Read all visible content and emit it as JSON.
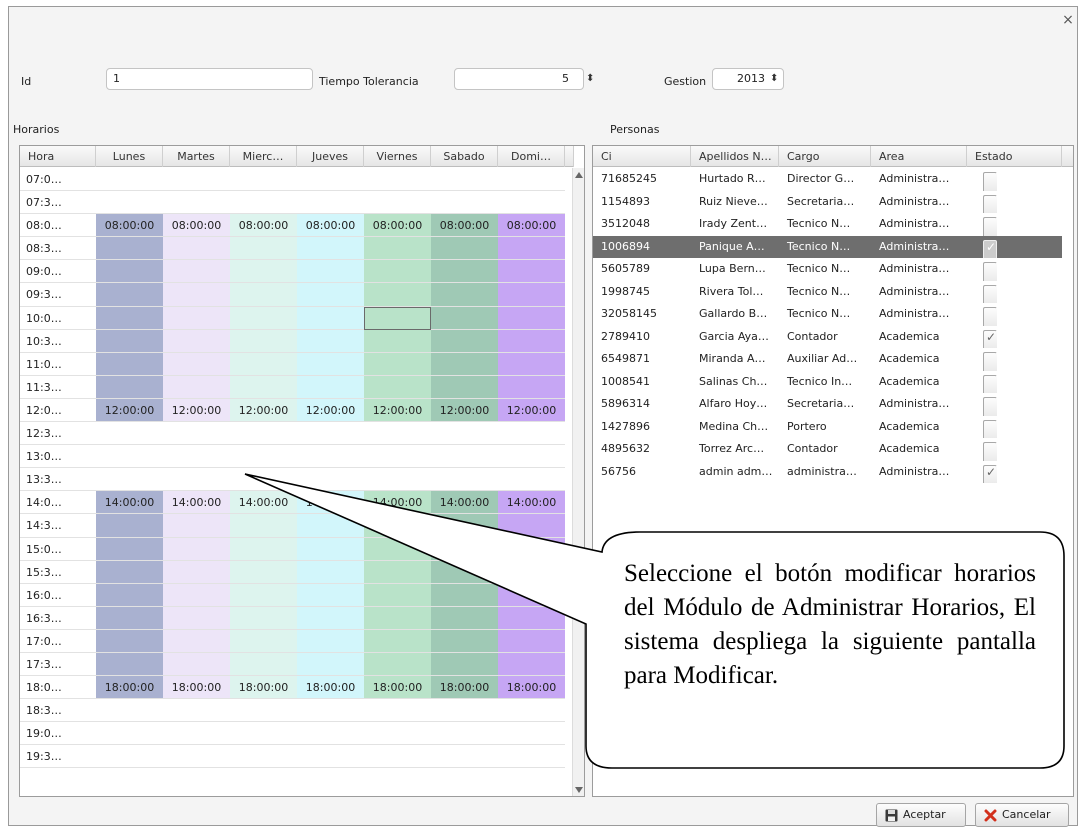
{
  "form": {
    "id_label": "Id",
    "id_value": "1",
    "tolerancia_label": "Tiempo Tolerancia",
    "tolerancia_value": "5",
    "gestion_label": "Gestion",
    "gestion_value": "2013"
  },
  "horarios": {
    "section_label": "Horarios",
    "columns": [
      "Hora",
      "Lunes",
      "Martes",
      "Mierc…",
      "Jueves",
      "Viernes",
      "Sabado",
      "Domi…"
    ],
    "day_colors": [
      "#a9b1d0",
      "#ede5f8",
      "#ddf4ee",
      "#d2f6fb",
      "#b9e3c9",
      "#9fc9b5",
      "#c6a6f4"
    ],
    "rows": [
      {
        "hora": "07:0…",
        "filled": false,
        "label": ""
      },
      {
        "hora": "07:3…",
        "filled": false,
        "label": ""
      },
      {
        "hora": "08:0…",
        "filled": true,
        "label": "08:00:00"
      },
      {
        "hora": "08:3…",
        "filled": true,
        "label": ""
      },
      {
        "hora": "09:0…",
        "filled": true,
        "label": ""
      },
      {
        "hora": "09:3…",
        "filled": true,
        "label": ""
      },
      {
        "hora": "10:0…",
        "filled": true,
        "label": ""
      },
      {
        "hora": "10:3…",
        "filled": true,
        "label": ""
      },
      {
        "hora": "11:0…",
        "filled": true,
        "label": ""
      },
      {
        "hora": "11:3…",
        "filled": true,
        "label": ""
      },
      {
        "hora": "12:0…",
        "filled": true,
        "label": "12:00:00"
      },
      {
        "hora": "12:3…",
        "filled": false,
        "label": ""
      },
      {
        "hora": "13:0…",
        "filled": false,
        "label": ""
      },
      {
        "hora": "13:3…",
        "filled": false,
        "label": ""
      },
      {
        "hora": "14:0…",
        "filled": true,
        "label": "14:00:00"
      },
      {
        "hora": "14:3…",
        "filled": true,
        "label": ""
      },
      {
        "hora": "15:0…",
        "filled": true,
        "label": ""
      },
      {
        "hora": "15:3…",
        "filled": true,
        "label": ""
      },
      {
        "hora": "16:0…",
        "filled": true,
        "label": ""
      },
      {
        "hora": "16:3…",
        "filled": true,
        "label": ""
      },
      {
        "hora": "17:0…",
        "filled": true,
        "label": ""
      },
      {
        "hora": "17:3…",
        "filled": true,
        "label": ""
      },
      {
        "hora": "18:0…",
        "filled": true,
        "label": "18:00:00"
      },
      {
        "hora": "18:3…",
        "filled": false,
        "label": ""
      },
      {
        "hora": "19:0…",
        "filled": false,
        "label": ""
      },
      {
        "hora": "19:3…",
        "filled": false,
        "label": ""
      }
    ]
  },
  "personas": {
    "section_label": "Personas",
    "columns": [
      "Ci",
      "Apellidos N…",
      "Cargo",
      "Area",
      "Estado"
    ],
    "rows": [
      {
        "ci": "71685245",
        "apellidos": "Hurtado R…",
        "cargo": "Director G…",
        "area": "Administra…",
        "estado": false,
        "selected": false
      },
      {
        "ci": "1154893",
        "apellidos": "Ruiz Nieve…",
        "cargo": "Secretaria…",
        "area": "Administra…",
        "estado": false,
        "selected": false
      },
      {
        "ci": "3512048",
        "apellidos": "Irady Zent…",
        "cargo": "Tecnico N…",
        "area": "Administra…",
        "estado": false,
        "selected": false
      },
      {
        "ci": "1006894",
        "apellidos": "Panique A…",
        "cargo": "Tecnico N…",
        "area": "Administra…",
        "estado": true,
        "selected": true
      },
      {
        "ci": "5605789",
        "apellidos": "Lupa Bern…",
        "cargo": "Tecnico N…",
        "area": "Administra…",
        "estado": false,
        "selected": false
      },
      {
        "ci": "1998745",
        "apellidos": "Rivera Tol…",
        "cargo": "Tecnico N…",
        "area": "Administra…",
        "estado": false,
        "selected": false
      },
      {
        "ci": "32058145",
        "apellidos": "Gallardo B…",
        "cargo": "Tecnico N…",
        "area": "Administra…",
        "estado": false,
        "selected": false
      },
      {
        "ci": "2789410",
        "apellidos": "Garcia Aya…",
        "cargo": "Contador",
        "area": "Academica",
        "estado": true,
        "selected": false
      },
      {
        "ci": "6549871",
        "apellidos": "Miranda A…",
        "cargo": "Auxiliar Ad…",
        "area": "Academica",
        "estado": false,
        "selected": false
      },
      {
        "ci": "1008541",
        "apellidos": "Salinas Ch…",
        "cargo": "Tecnico In…",
        "area": "Academica",
        "estado": false,
        "selected": false
      },
      {
        "ci": "5896314",
        "apellidos": "Alfaro Hoy…",
        "cargo": "Secretaria…",
        "area": "Administra…",
        "estado": false,
        "selected": false
      },
      {
        "ci": "1427896",
        "apellidos": "Medina Ch…",
        "cargo": "Portero",
        "area": "Academica",
        "estado": false,
        "selected": false
      },
      {
        "ci": "4895632",
        "apellidos": "Torrez Arc…",
        "cargo": "Contador",
        "area": "Academica",
        "estado": false,
        "selected": false
      },
      {
        "ci": "56756",
        "apellidos": "admin adm…",
        "cargo": "administra…",
        "area": "Administra…",
        "estado": true,
        "selected": false
      }
    ]
  },
  "buttons": {
    "aceptar": "Aceptar",
    "cancelar": "Cancelar"
  },
  "callout": {
    "text": "Seleccione el botón modificar horarios del Módulo de Administrar Horarios, El sistema despliega la siguiente pantalla para Modificar."
  },
  "icons": {
    "close": "close-icon",
    "save": "floppy-disk-icon",
    "cancel": "red-x-icon",
    "spinner": "up-down-spinner-icon"
  }
}
